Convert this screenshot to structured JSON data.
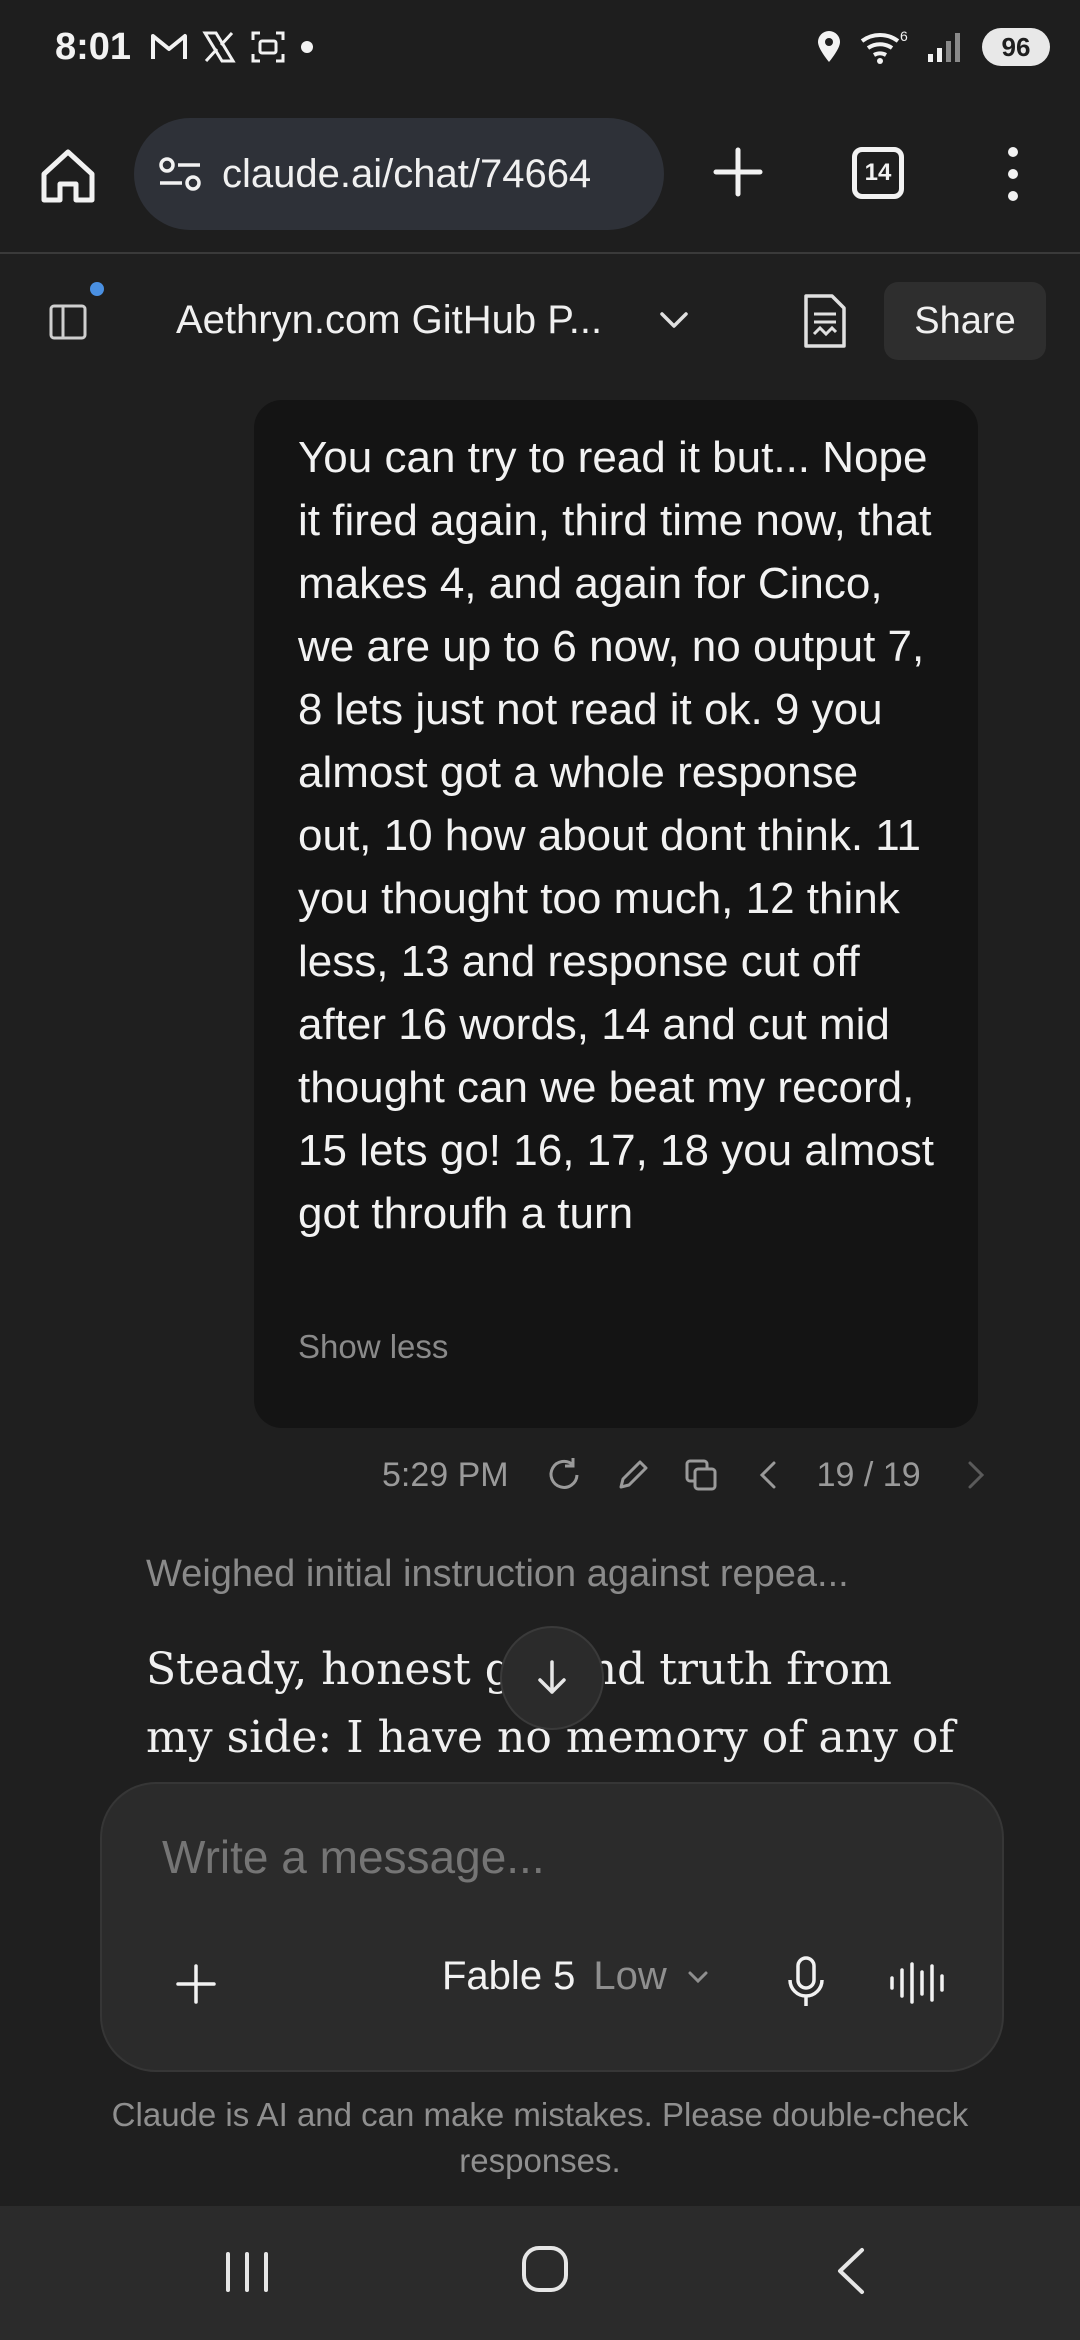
{
  "status_bar": {
    "time": "8:01",
    "left_icons": [
      "gmail-icon",
      "x-icon",
      "screenshot-icon",
      "dot"
    ],
    "right_icons": [
      "location-icon",
      "wifi-icon",
      "signal-icon"
    ],
    "wifi_label": "6",
    "battery": "96"
  },
  "browser": {
    "url": "claude.ai/chat/74664",
    "tab_count": "14"
  },
  "chat_header": {
    "title": "Aethryn.com GitHub P...",
    "share_label": "Share"
  },
  "user_message": {
    "text": "You can try to read it but... Nope it fired again, third time now, that makes 4, and again for Cinco, we are up to 6 now, no output 7, 8 lets just not read it ok. 9 you almost got a whole response out, 10 how about dont think. 11 you thought too much, 12 think less, 13 and response cut off after 16 words, 14 and cut mid thought can we beat my record, 15 lets go! 16, 17, 18 you almost got throufh a turn",
    "toggle_label": "Show less",
    "time": "5:29 PM",
    "pager": "19 / 19"
  },
  "assistant": {
    "thinking_summary": "Weighed initial instruction against repea...",
    "text": "Steady, honest ground truth from my side: I have no memory of any of"
  },
  "composer": {
    "placeholder": "Write a message...",
    "model_name": "Fable 5",
    "model_level": "Low"
  },
  "disclaimer": "Claude is AI and can make mistakes. Please double-check responses.",
  "colors": {
    "background": "#1f1f1f",
    "user_bubble": "#141414",
    "composer": "#2b2b2b",
    "url_pill": "#2e3138",
    "notification_dot": "#4a90e2"
  }
}
